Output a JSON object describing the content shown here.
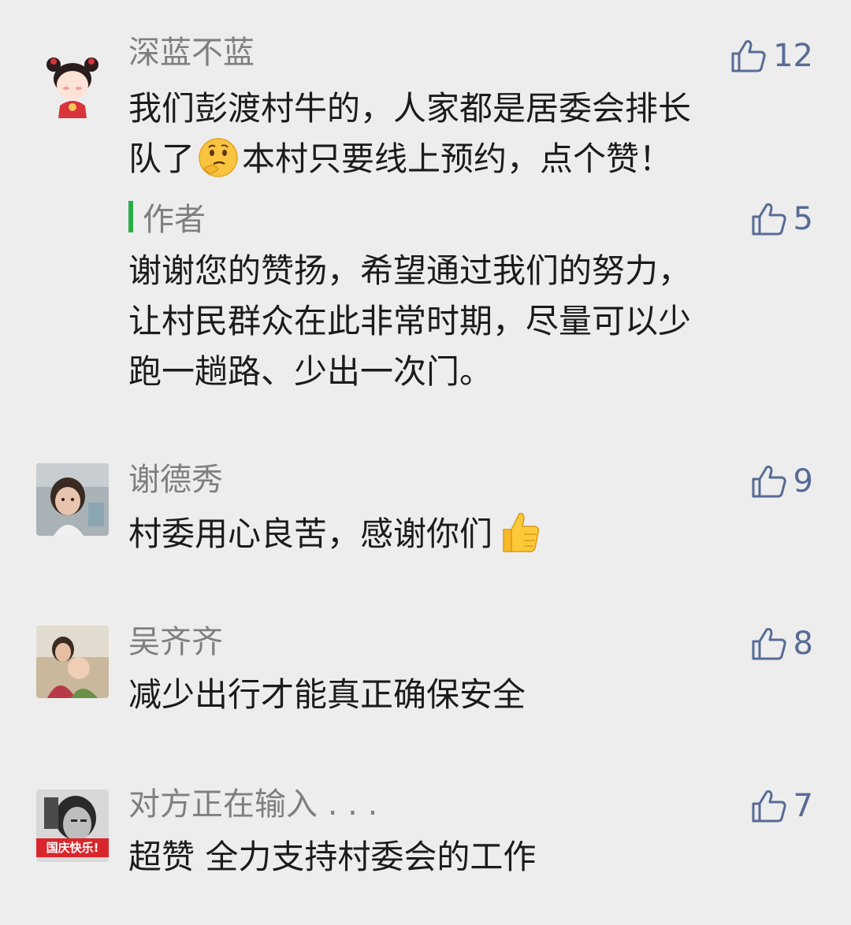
{
  "comments": [
    {
      "user": "深蓝不蓝",
      "likes": "12",
      "text_1": "我们彭渡村牛的，人家都是居委会排长",
      "text_2a": "队了",
      "text_2b": "本村只要线上预约，点个赞！",
      "emoji": "thinking-face-emoji",
      "reply": {
        "label": "作者",
        "likes": "5",
        "line_1": "谢谢您的赞扬，希望通过我们的努力，",
        "line_2": "让村民群众在此非常时期，尽量可以少",
        "line_3": "跑一趟路、少出一次门。"
      }
    },
    {
      "user": "谢德秀",
      "likes": "9",
      "text": "村委用心良苦，感谢你们",
      "emoji": "thumbs-up-emoji"
    },
    {
      "user": "吴齐齐",
      "likes": "8",
      "text": "减少出行才能真正确保安全"
    },
    {
      "user": "对方正在输入 . . .",
      "likes": "7",
      "text": "超赞 全力支持村委会的工作",
      "avatar_badge": "国庆快乐!"
    }
  ],
  "colors": {
    "background": "#ededed",
    "like_blue": "#576b95",
    "author_green": "#2bad4a",
    "username_gray": "#7f7f7f"
  }
}
